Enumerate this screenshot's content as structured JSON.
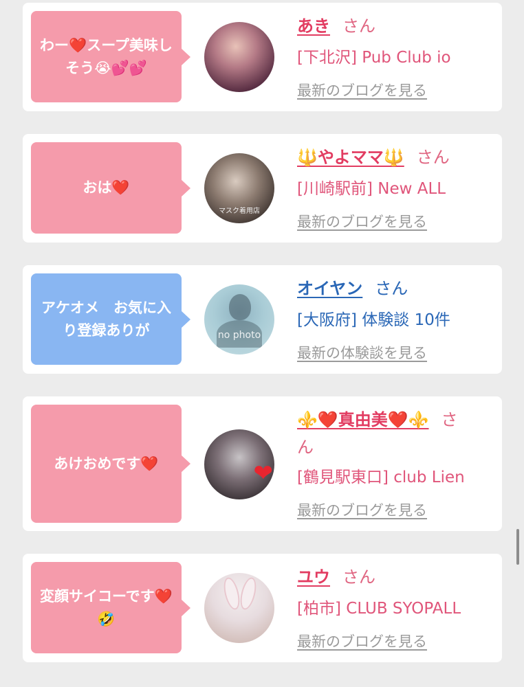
{
  "cards": [
    {
      "message": "わー❤️スープ美味しそう😭💕💕",
      "name": "あき",
      "honorific": "さん",
      "shop": "[下北沢] Pub Club io",
      "link": "最新のブログを見る"
    },
    {
      "message": "おは❤️",
      "name": "🔱やよママ🔱",
      "honorific": "さん",
      "shop": "[川崎駅前] New ALL",
      "link": "最新のブログを見る",
      "avatar_caption": "マスク着用店"
    },
    {
      "message": "アケオメ　お気に入り登録ありが",
      "name": "オイヤン",
      "honorific": "さん",
      "shop": "[大阪府] 体験談 10件",
      "link": "最新の体験談を見る",
      "avatar_caption": "no photo"
    },
    {
      "message": "あけおめです❤️",
      "name": "⚜️❤️真由美❤️⚜️",
      "honorific": "さ\nん",
      "shop": "[鶴見駅東口] club Lien",
      "link": "最新のブログを見る"
    },
    {
      "message": "変顔サイコーです❤️🤣",
      "name": "ユウ",
      "honorific": "さん",
      "shop": "[柏市] CLUB SYOPALL",
      "link": "最新のブログを見る"
    }
  ],
  "colors": {
    "bubble_pink": "#f59bab",
    "bubble_blue": "#89b6f2",
    "name_pink": "#e23c61",
    "name_blue": "#2a67b6",
    "link_gray": "#9a9a9a"
  }
}
